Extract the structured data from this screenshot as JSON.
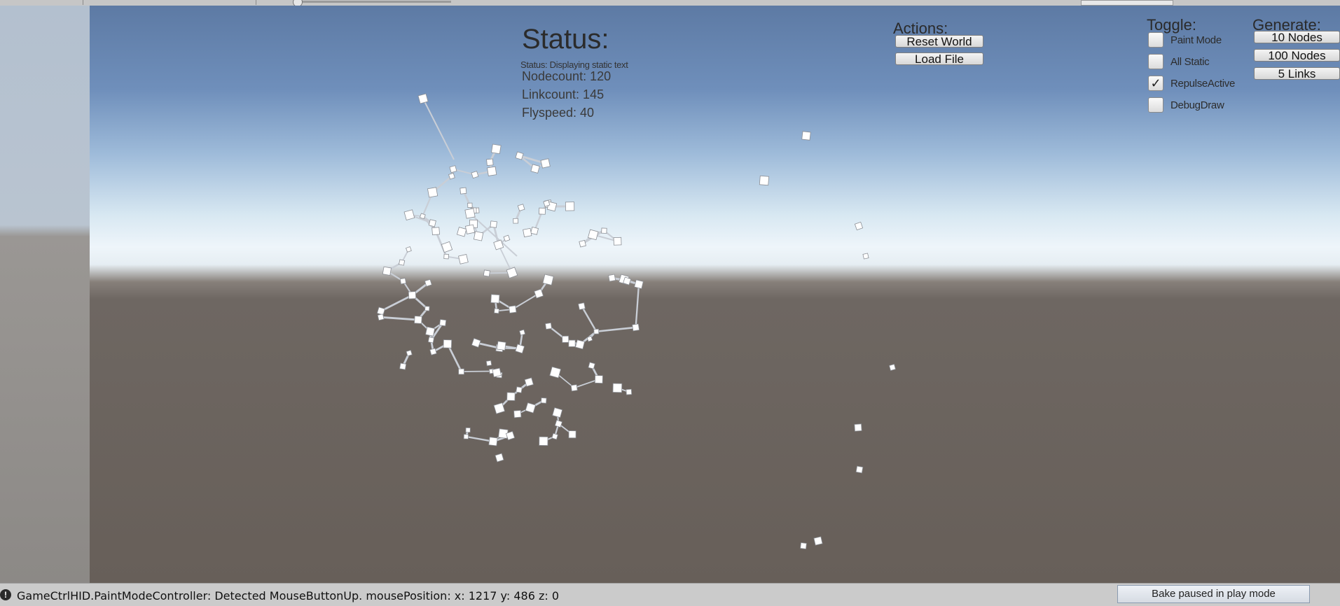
{
  "hud": {
    "status_title": "Status:",
    "status_line": "Status:  Displaying static text",
    "nodecount": "Nodecount: 120",
    "linkcount": "Linkcount: 145",
    "flyspeed": "Flyspeed: 40"
  },
  "actions": {
    "title": "Actions:",
    "reset_world": "Reset World",
    "load_file": "Load File"
  },
  "toggles": {
    "title": "Toggle:",
    "items": [
      {
        "label": "Paint Mode",
        "checked": false
      },
      {
        "label": "All Static",
        "checked": false
      },
      {
        "label": "RepulseActive",
        "checked": true
      },
      {
        "label": "DebugDraw",
        "checked": false
      }
    ]
  },
  "generate": {
    "title": "Generate:",
    "ten_nodes": "10 Nodes",
    "hundred_nodes": "100 Nodes",
    "five_links": "5 Links"
  },
  "statusbar": {
    "icon": "!",
    "console_message": "GameCtrlHID.PaintModeController: Detected MouseButtonUp. mousePosition: x: 1217  y: 486  z: 0",
    "bake_status": "Bake paused in play mode"
  },
  "icons": {
    "warning": "warning-icon",
    "check": "checkmark-icon"
  },
  "colors": {
    "sky_top": "#5d7aa4",
    "horizon": "#eef5fa",
    "ground": "#675f59",
    "link": "#c9ced6",
    "node": "#ffffff"
  }
}
